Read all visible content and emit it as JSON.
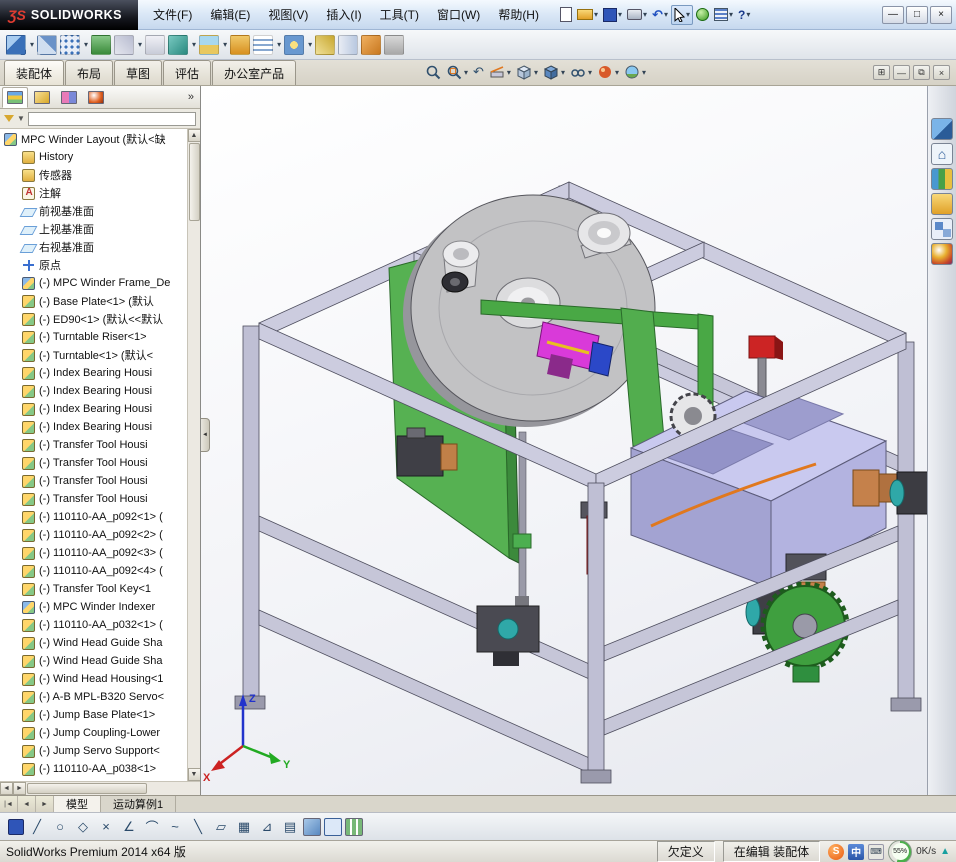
{
  "titlebar": {
    "logo_prefix": "ƷS",
    "logo_text": "SOLIDWORKS",
    "menus": [
      "文件(F)",
      "编辑(E)",
      "视图(V)",
      "插入(I)",
      "工具(T)",
      "窗口(W)",
      "帮助(H)"
    ],
    "toolbar_icons": [
      "new-icon",
      "open-icon",
      "save-icon",
      "print-icon",
      "undo-icon",
      "select-cursor-icon",
      "rebuild-icon",
      "options-icon",
      "help-icon"
    ]
  },
  "ribbon": {
    "tabs": [
      "装配体",
      "布局",
      "草图",
      "评估",
      "办公室产品"
    ],
    "active_tab": "装配体",
    "assembly_tool_icons": [
      "insert-components-icon",
      "mate-icon",
      "linear-component-pattern-icon",
      "smart-fasteners-icon",
      "move-component-icon",
      "show-hidden-components-icon",
      "assembly-features-icon",
      "reference-geometry-icon",
      "new-motion-study-icon",
      "bill-of-materials-icon",
      "exploded-view-icon",
      "explode-line-sketch-icon",
      "curve-icon",
      "instant3d-icon",
      "external-reference-icon"
    ]
  },
  "hud": {
    "icons": [
      "zoom-fit-icon",
      "zoom-area-icon",
      "previous-view-icon",
      "section-view-icon",
      "view-orientation-icon",
      "display-style-icon",
      "hide-show-items-icon",
      "edit-appearance-icon",
      "apply-scene-icon"
    ]
  },
  "task_pane": {
    "icons": [
      "solidworks-resources-icon",
      "design-library-icon",
      "file-explorer-icon",
      "view-palette-icon",
      "appearances-scenes-icon",
      "custom-properties-icon"
    ]
  },
  "feature_panel": {
    "tab_icons": [
      "featuremanager-tree-icon",
      "propertymanager-icon",
      "configurationmanager-icon",
      "dimxpertmanager-icon"
    ],
    "overflow": "»",
    "root": {
      "label": "MPC Winder Layout (默认<缺",
      "icon": "assembly"
    },
    "items": [
      {
        "label": "History",
        "icon": "history"
      },
      {
        "label": "传感器",
        "icon": "sensors"
      },
      {
        "label": "注解",
        "icon": "annotations"
      },
      {
        "label": "前视基准面",
        "icon": "plane"
      },
      {
        "label": "上视基准面",
        "icon": "plane"
      },
      {
        "label": "右视基准面",
        "icon": "plane"
      },
      {
        "label": "原点",
        "icon": "origin"
      },
      {
        "label": "(-) MPC Winder Frame_De",
        "icon": "assembly"
      },
      {
        "label": "(-) Base Plate<1> (默认",
        "icon": "part"
      },
      {
        "label": "(-) ED90<1> (默认<<默认",
        "icon": "part"
      },
      {
        "label": "(-) Turntable Riser<1>",
        "icon": "part"
      },
      {
        "label": "(-) Turntable<1> (默认<",
        "icon": "part"
      },
      {
        "label": "(-) Index Bearing Housi",
        "icon": "part"
      },
      {
        "label": "(-) Index Bearing Housi",
        "icon": "part"
      },
      {
        "label": "(-) Index Bearing Housi",
        "icon": "part"
      },
      {
        "label": "(-) Index Bearing Housi",
        "icon": "part"
      },
      {
        "label": "(-) Transfer Tool Housi",
        "icon": "part"
      },
      {
        "label": "(-) Transfer Tool Housi",
        "icon": "part"
      },
      {
        "label": "(-) Transfer Tool Housi",
        "icon": "part"
      },
      {
        "label": "(-) Transfer Tool Housi",
        "icon": "part"
      },
      {
        "label": "(-) 110110-AA_p092<1> (",
        "icon": "part"
      },
      {
        "label": "(-) 110110-AA_p092<2> (",
        "icon": "part"
      },
      {
        "label": "(-) 110110-AA_p092<3> (",
        "icon": "part"
      },
      {
        "label": "(-) 110110-AA_p092<4> (",
        "icon": "part"
      },
      {
        "label": "(-) Transfer Tool Key<1",
        "icon": "part"
      },
      {
        "label": "(-) MPC Winder Indexer",
        "icon": "assembly"
      },
      {
        "label": "(-) 110110-AA_p032<1> (",
        "icon": "part"
      },
      {
        "label": "(-) Wind Head Guide Sha",
        "icon": "part"
      },
      {
        "label": "(-) Wind Head Guide Sha",
        "icon": "part"
      },
      {
        "label": "(-) Wind Head Housing<1",
        "icon": "part"
      },
      {
        "label": "(-) A-B MPL-B320 Servo<",
        "icon": "part"
      },
      {
        "label": "(-) Jump Base Plate<1>",
        "icon": "part"
      },
      {
        "label": "(-) Jump Coupling-Lower",
        "icon": "part"
      },
      {
        "label": "(-) Jump Servo Support<",
        "icon": "part"
      },
      {
        "label": "(-) 110110-AA_p038<1>",
        "icon": "part"
      }
    ]
  },
  "viewport": {
    "triad": {
      "x": "X",
      "y": "Y",
      "z": "Z"
    }
  },
  "bottom_bar": {
    "tabs": [
      "模型",
      "运动算例1"
    ],
    "active_tab": "模型"
  },
  "sketch_toolbar": {
    "icons": [
      "save-icon",
      "sketch-line-icon",
      "sketch-circle-icon",
      "sketch-polygon-icon",
      "sketch-trim-icon",
      "sketch-angle-icon",
      "sketch-arc-icon",
      "sketch-spline-icon",
      "sketch-mirror-icon",
      "sketch-parallelogram-icon",
      "sketch-grid-icon",
      "sketch-triangle-icon",
      "sketch-hatch-icon",
      "view-cube-icon",
      "view-window-icon",
      "table-icon"
    ]
  },
  "statusbar": {
    "app_version": "SolidWorks Premium 2014 x64 版",
    "definition_status": "欠定义",
    "edit_status": "在编辑 装配体",
    "ime_indicator": "中",
    "sogou_badge": "S",
    "battery_percent": "55%",
    "network_rate": "0K/s"
  },
  "colors": {
    "frame_gray": "#ccccdf",
    "plate_green": "#56b152",
    "tub_lavender": "#c9c9ef",
    "disc_gray": "#c2c2c4",
    "cable_orange": "#e0781e",
    "block_red": "#cc2424",
    "motor_teal": "#2fa8a8",
    "gear_green": "#3f9f3f",
    "mate_magenta": "#d93ad9"
  }
}
